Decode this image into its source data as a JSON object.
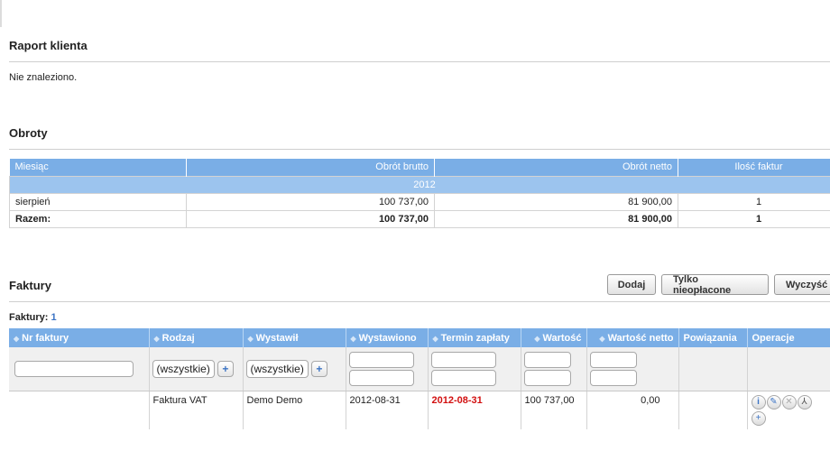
{
  "report": {
    "title": "Raport klienta",
    "not_found": "Nie znaleziono."
  },
  "obroty": {
    "title": "Obroty",
    "headers": [
      "Miesiąc",
      "Obrót brutto",
      "Obrót netto",
      "Ilość faktur"
    ],
    "year": "2012",
    "rows": [
      {
        "month": "sierpień",
        "brutto": "100 737,00",
        "netto": "81 900,00",
        "count": "1"
      }
    ],
    "total": {
      "label": "Razem:",
      "brutto": "100 737,00",
      "netto": "81 900,00",
      "count": "1"
    }
  },
  "faktury": {
    "title": "Faktury",
    "count_label": "Faktury:",
    "count": "1",
    "buttons": {
      "add": "Dodaj",
      "unpaid": "Tylko nieopłacone",
      "clear": "Wyczyść"
    },
    "headers": [
      "Nr faktury",
      "Rodzaj",
      "Wystawił",
      "Wystawiono",
      "Termin zapłaty",
      "Wartość",
      "Wartość netto",
      "Powiązania",
      "Operacje"
    ],
    "filter_all": "(wszystkie)",
    "rows": [
      {
        "nr": "",
        "rodzaj": "Faktura VAT",
        "wystawil": "Demo Demo",
        "wystawiono": "2012-08-31",
        "termin": "2012-08-31",
        "wartosc": "100 737,00",
        "netto": "0,00",
        "powiazania": ""
      }
    ],
    "colors": {
      "header": "#7aaee6",
      "overdue": "#d21010"
    }
  }
}
